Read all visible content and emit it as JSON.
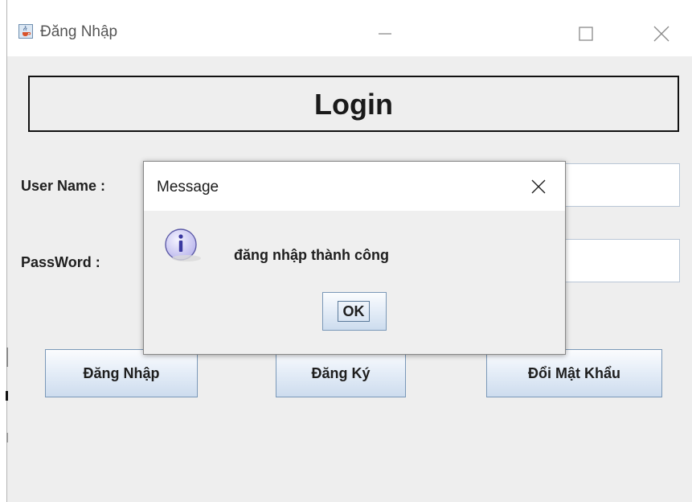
{
  "window": {
    "title": "Đăng Nhập",
    "icon": "java-cup-icon",
    "controls": [
      "minimize-icon",
      "maximize-icon",
      "close-icon"
    ]
  },
  "form": {
    "header": "Login",
    "username_label": "User Name :",
    "username_value": "",
    "password_label": "PassWord :",
    "password_value": ""
  },
  "buttons": {
    "login": "Đăng Nhập",
    "register": "Đăng Ký",
    "change_password": "Đổi Mật Khẩu"
  },
  "dialog": {
    "title": "Message",
    "icon": "info-icon",
    "message": "đăng nhập thành công",
    "ok_label": "OK"
  },
  "colors": {
    "background": "#eeeeee",
    "button_border": "#7a98b8",
    "info_icon": "#b8b4ec"
  }
}
